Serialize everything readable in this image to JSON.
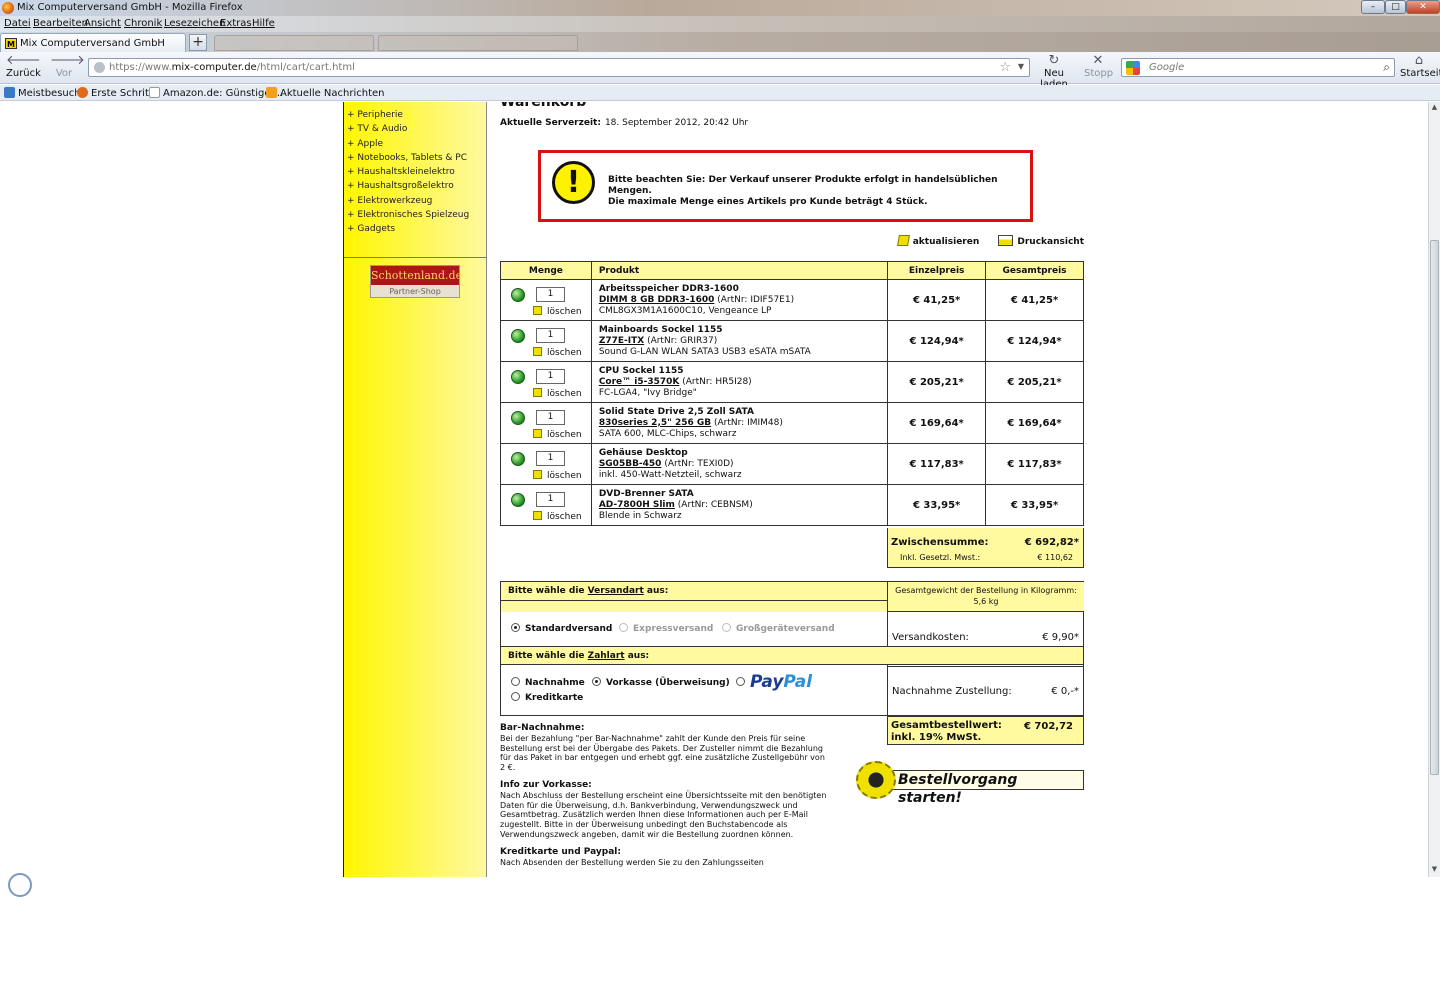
{
  "window": {
    "title": "Mix Computerversand GmbH - Mozilla Firefox",
    "min": "–",
    "max": "□",
    "close": "✕"
  },
  "menu": [
    "Datei",
    "Bearbeiten",
    "Ansicht",
    "Chronik",
    "Lesezeichen",
    "Extras",
    "Hilfe"
  ],
  "tabs": {
    "active": "Mix Computerversand GmbH",
    "favicon": "M",
    "new_tab": "+"
  },
  "nav": {
    "back": "Zurück",
    "forward": "Vor",
    "url_prefix": "https://www.",
    "url_domain": "mix-computer.de",
    "url_path": "/html/cart/cart.html",
    "reload": "Neu laden",
    "stop": "Stopp",
    "search_placeholder": "Google",
    "home": "Startseite"
  },
  "bookmarks": [
    "Meistbesucht",
    "Erste Schritte",
    "Amazon.de: Günstige ...",
    "Aktuelle Nachrichten"
  ],
  "sidebar": {
    "categories": [
      "+ Peripherie",
      "+ TV & Audio",
      "+ Apple",
      "+ Notebooks, Tablets & PC",
      "+ Haushaltskleinelektro",
      "+ Haushaltsgroßelektro",
      "+ Elektrowerkzeug",
      "+ Elektronisches Spielzeug",
      "+ Gadgets"
    ],
    "partner_name": "Schottenland.de",
    "partner_sub": "Partner-Shop"
  },
  "page": {
    "title": "Warenkorb",
    "servertime_label": "Aktuelle Serverzeit:",
    "servertime_value": "18. September 2012, 20:42 Uhr",
    "notice_line1": "Bitte beachten Sie: Der Verkauf unserer Produkte erfolgt in handelsüblichen Mengen.",
    "notice_line2": "Die maximale Menge eines Artikels pro Kunde beträgt 4 Stück.",
    "refresh": "aktualisieren",
    "print": "Druckansicht"
  },
  "cart": {
    "headers": [
      "Menge",
      "Produkt",
      "Einzelpreis",
      "Gesamtpreis"
    ],
    "delete_label": "löschen",
    "items": [
      {
        "qty": "1",
        "category": "Arbeitsspeicher DDR3-1600",
        "model": "DIMM 8 GB DDR3-1600",
        "artnr": "(ArtNr: IDIF57E1)",
        "desc": "CML8GX3M1A1600C10, Vengeance LP",
        "price": "€ 41,25*",
        "total": "€ 41,25*"
      },
      {
        "qty": "1",
        "category": "Mainboards Sockel 1155",
        "model": "Z77E-ITX",
        "artnr": "(ArtNr: GRIR37)",
        "desc": "Sound G-LAN WLAN SATA3 USB3 eSATA mSATA",
        "price": "€ 124,94*",
        "total": "€ 124,94*"
      },
      {
        "qty": "1",
        "category": "CPU Sockel 1155",
        "model": "Core™ i5-3570K",
        "artnr": "(ArtNr: HR5I28)",
        "desc": "FC-LGA4, \"Ivy Bridge\"",
        "price": "€ 205,21*",
        "total": "€ 205,21*"
      },
      {
        "qty": "1",
        "category": "Solid State Drive 2,5 Zoll SATA",
        "model": "830series 2,5\" 256 GB",
        "artnr": "(ArtNr: IMIM48)",
        "desc": "SATA 600, MLC-Chips, schwarz",
        "price": "€ 169,64*",
        "total": "€ 169,64*"
      },
      {
        "qty": "1",
        "category": "Gehäuse Desktop",
        "model": "SG05BB-450",
        "artnr": "(ArtNr: TEXI0D)",
        "desc": "inkl. 450-Watt-Netzteil, schwarz",
        "price": "€ 117,83*",
        "total": "€ 117,83*"
      },
      {
        "qty": "1",
        "category": "DVD-Brenner SATA",
        "model": "AD-7800H Slim",
        "artnr": "(ArtNr: CEBNSM)",
        "desc": "Blende in Schwarz",
        "price": "€ 33,95*",
        "total": "€ 33,95*"
      }
    ],
    "subtotal_label": "Zwischensumme:",
    "subtotal_value": "€ 692,82*",
    "vat_label": "Inkl. Gesetzl. Mwst.:",
    "vat_value": "€ 110,62"
  },
  "shipping": {
    "prompt_pre": "Bitte wähle die ",
    "prompt_link": "Versandart",
    "prompt_post": " aus:",
    "weight_label": "Gesamtgewicht der Bestellung in Kilogramm:",
    "weight_value": "5,6 kg",
    "options": [
      "Standardversand",
      "Expressversand",
      "Großgeräteversand"
    ],
    "cost_label": "Versandkosten:",
    "cost_value": "€ 9,90*"
  },
  "payment": {
    "prompt_pre": "Bitte wähle die ",
    "prompt_link": "Zahlart",
    "prompt_post": " aus:",
    "options": [
      "Nachnahme",
      "Vorkasse (Überweisung)",
      "Kreditkarte"
    ],
    "paypal_a": "Pay",
    "paypal_b": "Pal",
    "cod_label": "Nachnahme Zustellung:",
    "cod_value": "€ 0,-*"
  },
  "total": {
    "label1": "Gesamtbestellwert:",
    "label2": "inkl. 19% MwSt.",
    "value": "€ 702,72"
  },
  "info": {
    "h1": "Bar-Nachnahme:",
    "p1": "Bei der Bezahlung \"per Bar-Nachnahme\" zahlt der Kunde den Preis für seine Bestellung erst bei der Übergabe des Pakets. Der Zusteller nimmt die Bezahlung für das Paket in bar entgegen und erhebt ggf. eine zusätzliche Zustellgebühr von 2 €.",
    "h2": "Info zur Vorkasse:",
    "p2": "Nach Abschluss der Bestellung erscheint eine Übersichtsseite mit den benötigten Daten für die Überweisung, d.h. Bankverbindung, Verwendungszweck und Gesamtbetrag. Zusätzlich werden Ihnen diese Informationen auch per E-Mail zugestellt. Bitte in der Überweisung unbedingt den Buchstabencode als Verwendungszweck angeben, damit wir die Bestellung zuordnen können.",
    "h3": "Kreditkarte und Paypal:",
    "p3": "Nach Absenden der Bestellung werden Sie zu den Zahlungsseiten"
  },
  "checkout_label": "Bestellvorgang starten!"
}
